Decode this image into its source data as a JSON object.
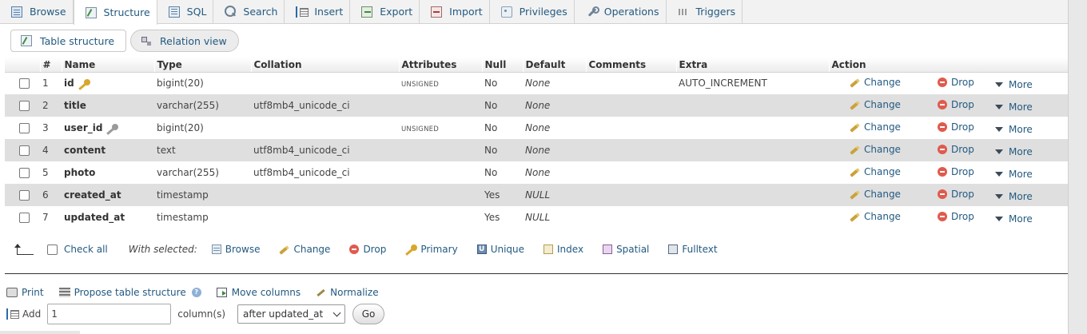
{
  "tabs": [
    {
      "label": "Browse",
      "icon": "browse-icon"
    },
    {
      "label": "Structure",
      "icon": "structure-icon"
    },
    {
      "label": "SQL",
      "icon": "sql-icon"
    },
    {
      "label": "Search",
      "icon": "search-icon"
    },
    {
      "label": "Insert",
      "icon": "insert-icon"
    },
    {
      "label": "Export",
      "icon": "export-icon"
    },
    {
      "label": "Import",
      "icon": "import-icon"
    },
    {
      "label": "Privileges",
      "icon": "privileges-icon"
    },
    {
      "label": "Operations",
      "icon": "wrench-icon"
    },
    {
      "label": "Triggers",
      "icon": "triggers-icon"
    }
  ],
  "active_tab": "Structure",
  "subtabs": [
    {
      "label": "Table structure",
      "icon": "table-structure-icon"
    },
    {
      "label": "Relation view",
      "icon": "relation-view-icon"
    }
  ],
  "table": {
    "headers": [
      "#",
      "Name",
      "Type",
      "Collation",
      "Attributes",
      "Null",
      "Default",
      "Comments",
      "Extra",
      "Action"
    ],
    "rows": [
      {
        "num": "1",
        "name": "id",
        "key": "primary",
        "type": "bigint(20)",
        "collation": "",
        "attributes": "UNSIGNED",
        "null": "No",
        "default": "None",
        "comments": "",
        "extra": "AUTO_INCREMENT"
      },
      {
        "num": "2",
        "name": "title",
        "key": "",
        "type": "varchar(255)",
        "collation": "utf8mb4_unicode_ci",
        "attributes": "",
        "null": "No",
        "default": "None",
        "comments": "",
        "extra": ""
      },
      {
        "num": "3",
        "name": "user_id",
        "key": "index",
        "type": "bigint(20)",
        "collation": "",
        "attributes": "UNSIGNED",
        "null": "No",
        "default": "None",
        "comments": "",
        "extra": ""
      },
      {
        "num": "4",
        "name": "content",
        "key": "",
        "type": "text",
        "collation": "utf8mb4_unicode_ci",
        "attributes": "",
        "null": "No",
        "default": "None",
        "comments": "",
        "extra": ""
      },
      {
        "num": "5",
        "name": "photo",
        "key": "",
        "type": "varchar(255)",
        "collation": "utf8mb4_unicode_ci",
        "attributes": "",
        "null": "No",
        "default": "None",
        "comments": "",
        "extra": ""
      },
      {
        "num": "6",
        "name": "created_at",
        "key": "",
        "type": "timestamp",
        "collation": "",
        "attributes": "",
        "null": "Yes",
        "default": "NULL",
        "comments": "",
        "extra": ""
      },
      {
        "num": "7",
        "name": "updated_at",
        "key": "",
        "type": "timestamp",
        "collation": "",
        "attributes": "",
        "null": "Yes",
        "default": "NULL",
        "comments": "",
        "extra": ""
      }
    ],
    "actions": {
      "change": "Change",
      "drop": "Drop",
      "more": "More"
    }
  },
  "check_all": {
    "label": "Check all",
    "with_selected": "With selected:",
    "actions": [
      {
        "label": "Browse",
        "icon": "browse-icon"
      },
      {
        "label": "Change",
        "icon": "pencil-icon"
      },
      {
        "label": "Drop",
        "icon": "drop-icon"
      },
      {
        "label": "Primary",
        "icon": "key-icon"
      },
      {
        "label": "Unique",
        "icon": "unique-icon"
      },
      {
        "label": "Index",
        "icon": "index-icon"
      },
      {
        "label": "Spatial",
        "icon": "spatial-icon"
      },
      {
        "label": "Fulltext",
        "icon": "fulltext-icon"
      }
    ]
  },
  "bottom_links": {
    "print": "Print",
    "propose": "Propose table structure",
    "move": "Move columns",
    "normalize": "Normalize"
  },
  "add_columns": {
    "label": "Add",
    "value": "1",
    "unit": "column(s)",
    "position": "after updated_at",
    "go": "Go"
  }
}
